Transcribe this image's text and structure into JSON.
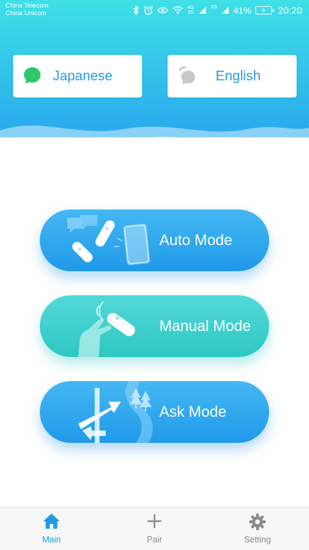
{
  "status_bar": {
    "carrier_1": "China Telecom",
    "carrier_2": "China Unicom",
    "net_1": "4G",
    "net_2": "2G",
    "net_3": "2G",
    "battery_percent": "41%",
    "time": "20:20"
  },
  "languages": {
    "source": {
      "label": "Japanese",
      "icon": "chat-bubble-icon"
    },
    "target": {
      "label": "English",
      "icon": "chat-bubble-icon"
    }
  },
  "modes": [
    {
      "label": "Auto Mode",
      "icon": "translator-devices-icon"
    },
    {
      "label": "Manual Mode",
      "icon": "hand-tap-icon"
    },
    {
      "label": "Ask Mode",
      "icon": "direction-sign-icon"
    }
  ],
  "tab_bar": {
    "tabs": [
      {
        "label": "Main",
        "icon": "home-icon",
        "active": true
      },
      {
        "label": "Pair",
        "icon": "plus-icon"
      },
      {
        "label": "Setting",
        "icon": "gear-icon"
      }
    ]
  },
  "colors": {
    "accent": "#1f9aea",
    "header_gradient_top": "#3fe0e6",
    "header_gradient_bottom": "#28a8ee",
    "teal": "#2ec7c2",
    "active_language_icon": "#2fc768",
    "inactive_language_icon": "#c8c8c8"
  }
}
